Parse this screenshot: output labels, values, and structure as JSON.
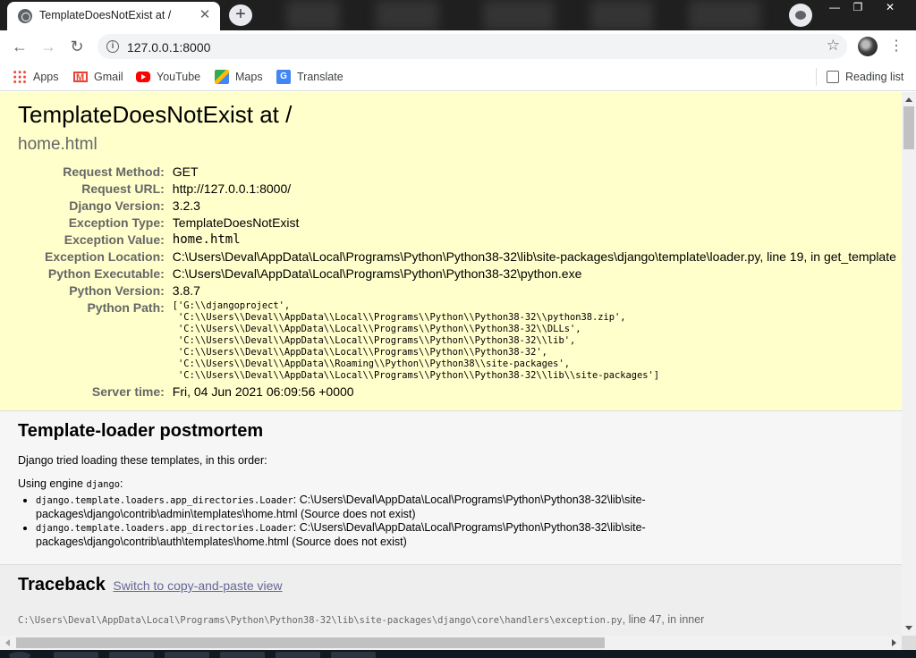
{
  "browser": {
    "tab_title": "TemplateDoesNotExist at /",
    "tab_close": "✕",
    "new_tab": "+",
    "url": "127.0.0.1:8000",
    "win_min": "—",
    "win_max": "❐",
    "win_close": "✕",
    "back": "←",
    "forward": "→",
    "reload": "↻",
    "star": "☆",
    "menu": "⋮",
    "info": "i"
  },
  "bookmarks": [
    {
      "label": "Apps",
      "icon": "apps-grid-icon"
    },
    {
      "label": "Gmail",
      "icon": "gmail-icon"
    },
    {
      "label": "YouTube",
      "icon": "youtube-icon"
    },
    {
      "label": "Maps",
      "icon": "maps-icon"
    },
    {
      "label": "Translate",
      "icon": "translate-icon"
    }
  ],
  "reading_list": "Reading list",
  "summary": {
    "title": "TemplateDoesNotExist at /",
    "subtitle": "home.html",
    "rows": [
      {
        "label": "Request Method:",
        "value": "GET"
      },
      {
        "label": "Request URL:",
        "value": "http://127.0.0.1:8000/"
      },
      {
        "label": "Django Version:",
        "value": "3.2.3"
      },
      {
        "label": "Exception Type:",
        "value": "TemplateDoesNotExist"
      },
      {
        "label": "Exception Value:",
        "value": "home.html"
      },
      {
        "label": "Exception Location:",
        "value": "C:\\Users\\Deval\\AppData\\Local\\Programs\\Python\\Python38-32\\lib\\site-packages\\django\\template\\loader.py, line 19, in get_template"
      },
      {
        "label": "Python Executable:",
        "value": "C:\\Users\\Deval\\AppData\\Local\\Programs\\Python\\Python38-32\\python.exe"
      },
      {
        "label": "Python Version:",
        "value": "3.8.7"
      },
      {
        "label": "Python Path:",
        "value": "['G:\\\\djangoproject',\n 'C:\\\\Users\\\\Deval\\\\AppData\\\\Local\\\\Programs\\\\Python\\\\Python38-32\\\\python38.zip',\n 'C:\\\\Users\\\\Deval\\\\AppData\\\\Local\\\\Programs\\\\Python\\\\Python38-32\\\\DLLs',\n 'C:\\\\Users\\\\Deval\\\\AppData\\\\Local\\\\Programs\\\\Python\\\\Python38-32\\\\lib',\n 'C:\\\\Users\\\\Deval\\\\AppData\\\\Local\\\\Programs\\\\Python\\\\Python38-32',\n 'C:\\\\Users\\\\Deval\\\\AppData\\\\Roaming\\\\Python\\\\Python38\\\\site-packages',\n 'C:\\\\Users\\\\Deval\\\\AppData\\\\Local\\\\Programs\\\\Python\\\\Python38-32\\\\lib\\\\site-packages']"
      },
      {
        "label": "Server time:",
        "value": "Fri, 04 Jun 2021 06:09:56 +0000"
      }
    ]
  },
  "postmortem": {
    "title": "Template-loader postmortem",
    "intro": "Django tried loading these templates, in this order:",
    "engine_prefix": "Using engine ",
    "engine_name": "django",
    "engine_suffix": ":",
    "items": [
      {
        "loader": "django.template.loaders.app_directories.Loader",
        "path": ": C:\\Users\\Deval\\AppData\\Local\\Programs\\Python\\Python38-32\\lib\\site-packages\\django\\contrib\\admin\\templates\\home.html (Source does not exist)"
      },
      {
        "loader": "django.template.loaders.app_directories.Loader",
        "path": ": C:\\Users\\Deval\\AppData\\Local\\Programs\\Python\\Python38-32\\lib\\site-packages\\django\\contrib\\auth\\templates\\home.html (Source does not exist)"
      }
    ]
  },
  "traceback": {
    "title": "Traceback",
    "switch_link": "Switch to copy-and-paste view",
    "frame_file": "C:\\Users\\Deval\\AppData\\Local\\Programs\\Python\\Python38-32\\lib\\site-packages\\django\\core\\handlers\\exception.py",
    "frame_rest": ", line 47, in inner"
  }
}
